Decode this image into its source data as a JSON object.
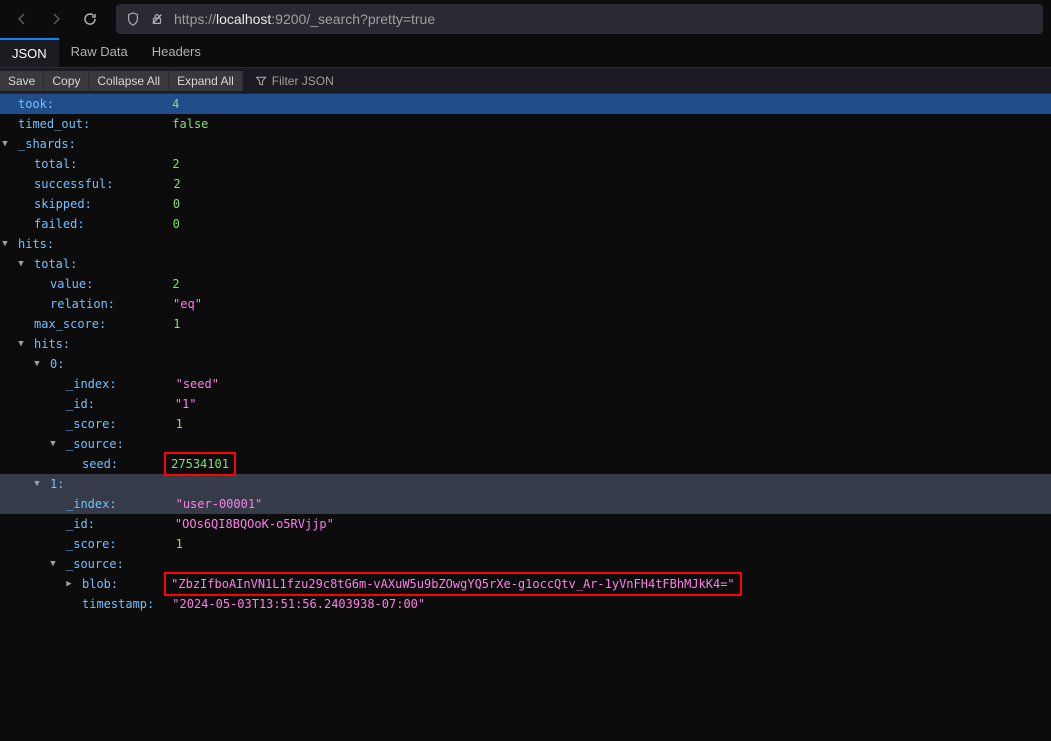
{
  "url": {
    "scheme": "https://",
    "host": "localhost",
    "rest": ":9200/_search?pretty=true"
  },
  "tabs": [
    "JSON",
    "Raw Data",
    "Headers"
  ],
  "toolbar": {
    "save": "Save",
    "copy": "Copy",
    "collapse": "Collapse All",
    "expand": "Expand All",
    "filter": "Filter JSON"
  },
  "j": {
    "took_k": "took",
    "took_v": "4",
    "timed_out_k": "timed_out",
    "timed_out_v": "false",
    "shards_k": "_shards",
    "sh_total_k": "total",
    "sh_total_v": "2",
    "sh_succ_k": "successful",
    "sh_succ_v": "2",
    "sh_skip_k": "skipped",
    "sh_skip_v": "0",
    "sh_fail_k": "failed",
    "sh_fail_v": "0",
    "hits_k": "hits",
    "h_total_k": "total",
    "h_total_val_k": "value",
    "h_total_val_v": "2",
    "h_total_rel_k": "relation",
    "h_total_rel_v": "\"eq\"",
    "h_max_k": "max_score",
    "h_max_v": "1",
    "h_hits_k": "hits",
    "h0_k": "0",
    "h0_index_k": "_index",
    "h0_index_v": "\"seed\"",
    "h0_id_k": "_id",
    "h0_id_v": "\"1\"",
    "h0_score_k": "_score",
    "h0_score_v": "1",
    "h0_src_k": "_source",
    "h0_seed_k": "seed",
    "h0_seed_v": "27534101",
    "h1_k": "1",
    "h1_index_k": "_index",
    "h1_index_v": "\"user-00001\"",
    "h1_id_k": "_id",
    "h1_id_v": "\"OOs6QI8BQOoK-o5RVjjp\"",
    "h1_score_k": "_score",
    "h1_score_v": "1",
    "h1_src_k": "_source",
    "h1_blob_k": "blob",
    "h1_blob_v": "\"ZbzIfboAInVN1L1fzu29c8tG6m-vAXuW5u9bZOwgYQ5rXe-g1occQtv_Ar-1yVnFH4tFBhMJkK4=\"",
    "h1_ts_k": "timestamp",
    "h1_ts_v": "\"2024-05-03T13:51:56.2403938-07:00\""
  }
}
